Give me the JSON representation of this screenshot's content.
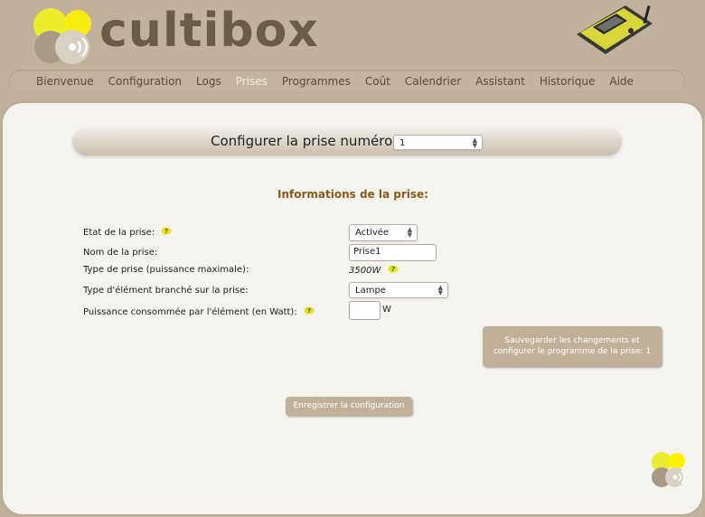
{
  "brand": {
    "name": "cultibox"
  },
  "nav": [
    {
      "label": "Bienvenue",
      "active": false
    },
    {
      "label": "Configuration",
      "active": false
    },
    {
      "label": "Logs",
      "active": false
    },
    {
      "label": "Prises",
      "active": true
    },
    {
      "label": "Programmes",
      "active": false
    },
    {
      "label": "Coût",
      "active": false
    },
    {
      "label": "Calendrier",
      "active": false
    },
    {
      "label": "Assistant",
      "active": false
    },
    {
      "label": "Historique",
      "active": false
    },
    {
      "label": "Aide",
      "active": false
    }
  ],
  "config": {
    "label": "Configurer la prise numéro",
    "selected": "1"
  },
  "section_title": "Informations de la prise:",
  "fields": {
    "state": {
      "label": "Etat de la prise:",
      "value": "Activée",
      "help_icon": "help-icon"
    },
    "name": {
      "label": "Nom de la prise:",
      "value": "Prise1"
    },
    "type": {
      "label": "Type de prise (puissance maximale):",
      "value": "3500W",
      "help_icon": "help-icon"
    },
    "element": {
      "label": "Type d'élément branché sur la prise:",
      "value": "Lampe"
    },
    "power": {
      "label": "Puissance consommée par l'élément (en Watt):",
      "value": "",
      "unit": "W",
      "help_icon": "help-icon"
    }
  },
  "buttons": {
    "save_program": "Sauvegarder les changements et configurer le programme de la prise: 1",
    "record": "Enregistrer la configuration"
  },
  "colors": {
    "background": "#c2b29d",
    "panel": "#f5f3ee",
    "logo_text": "#6a5c49",
    "section_title": "#8a5a1a",
    "button": "#c1b19a",
    "yellow": "#e8e82a"
  }
}
